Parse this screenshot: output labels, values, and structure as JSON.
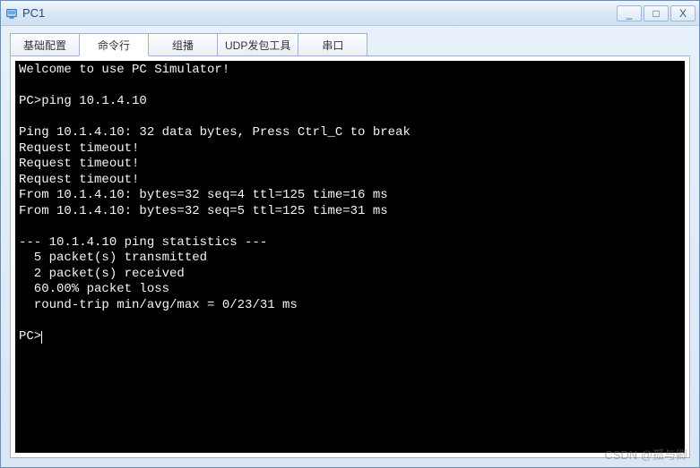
{
  "window": {
    "title": "PC1",
    "controls": {
      "minimize": "_",
      "maximize": "□",
      "close": "X"
    }
  },
  "tabs": [
    {
      "label": "基础配置",
      "active": false
    },
    {
      "label": "命令行",
      "active": true
    },
    {
      "label": "组播",
      "active": false
    },
    {
      "label": "UDP发包工具",
      "active": false
    },
    {
      "label": "串口",
      "active": false
    }
  ],
  "terminal": {
    "lines": [
      "Welcome to use PC Simulator!",
      "",
      "PC>ping 10.1.4.10",
      "",
      "Ping 10.1.4.10: 32 data bytes, Press Ctrl_C to break",
      "Request timeout!",
      "Request timeout!",
      "Request timeout!",
      "From 10.1.4.10: bytes=32 seq=4 ttl=125 time=16 ms",
      "From 10.1.4.10: bytes=32 seq=5 ttl=125 time=31 ms",
      "",
      "--- 10.1.4.10 ping statistics ---",
      "  5 packet(s) transmitted",
      "  2 packet(s) received",
      "  60.00% packet loss",
      "  round-trip min/avg/max = 0/23/31 ms",
      "",
      "PC>"
    ],
    "prompt": "PC>"
  },
  "watermark": "CSDN @孤与卿"
}
